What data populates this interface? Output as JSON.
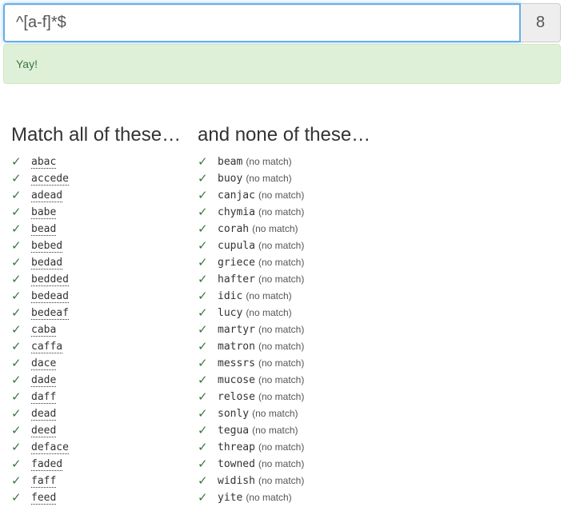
{
  "regex": {
    "value": "^[a-f]*$",
    "score": "8"
  },
  "alert": {
    "text": "Yay!"
  },
  "match": {
    "heading": "Match all of these…",
    "items": [
      {
        "word": "abac"
      },
      {
        "word": "accede"
      },
      {
        "word": "adead"
      },
      {
        "word": "babe"
      },
      {
        "word": "bead"
      },
      {
        "word": "bebed"
      },
      {
        "word": "bedad"
      },
      {
        "word": "bedded"
      },
      {
        "word": "bedead"
      },
      {
        "word": "bedeaf"
      },
      {
        "word": "caba"
      },
      {
        "word": "caffa"
      },
      {
        "word": "dace"
      },
      {
        "word": "dade"
      },
      {
        "word": "daff"
      },
      {
        "word": "dead"
      },
      {
        "word": "deed"
      },
      {
        "word": "deface"
      },
      {
        "word": "faded"
      },
      {
        "word": "faff"
      },
      {
        "word": "feed"
      }
    ]
  },
  "nomatch": {
    "heading": "and none of these…",
    "note": "(no match)",
    "items": [
      {
        "word": "beam"
      },
      {
        "word": "buoy"
      },
      {
        "word": "canjac"
      },
      {
        "word": "chymia"
      },
      {
        "word": "corah"
      },
      {
        "word": "cupula"
      },
      {
        "word": "griece"
      },
      {
        "word": "hafter"
      },
      {
        "word": "idic"
      },
      {
        "word": "lucy"
      },
      {
        "word": "martyr"
      },
      {
        "word": "matron"
      },
      {
        "word": "messrs"
      },
      {
        "word": "mucose"
      },
      {
        "word": "relose"
      },
      {
        "word": "sonly"
      },
      {
        "word": "tegua"
      },
      {
        "word": "threap"
      },
      {
        "word": "towned"
      },
      {
        "word": "widish"
      },
      {
        "word": "yite"
      }
    ]
  },
  "icons": {
    "check": "✓"
  },
  "colors": {
    "success": "#3c763d",
    "alert_bg": "#dff0d8",
    "focus_border": "#66afe9"
  }
}
